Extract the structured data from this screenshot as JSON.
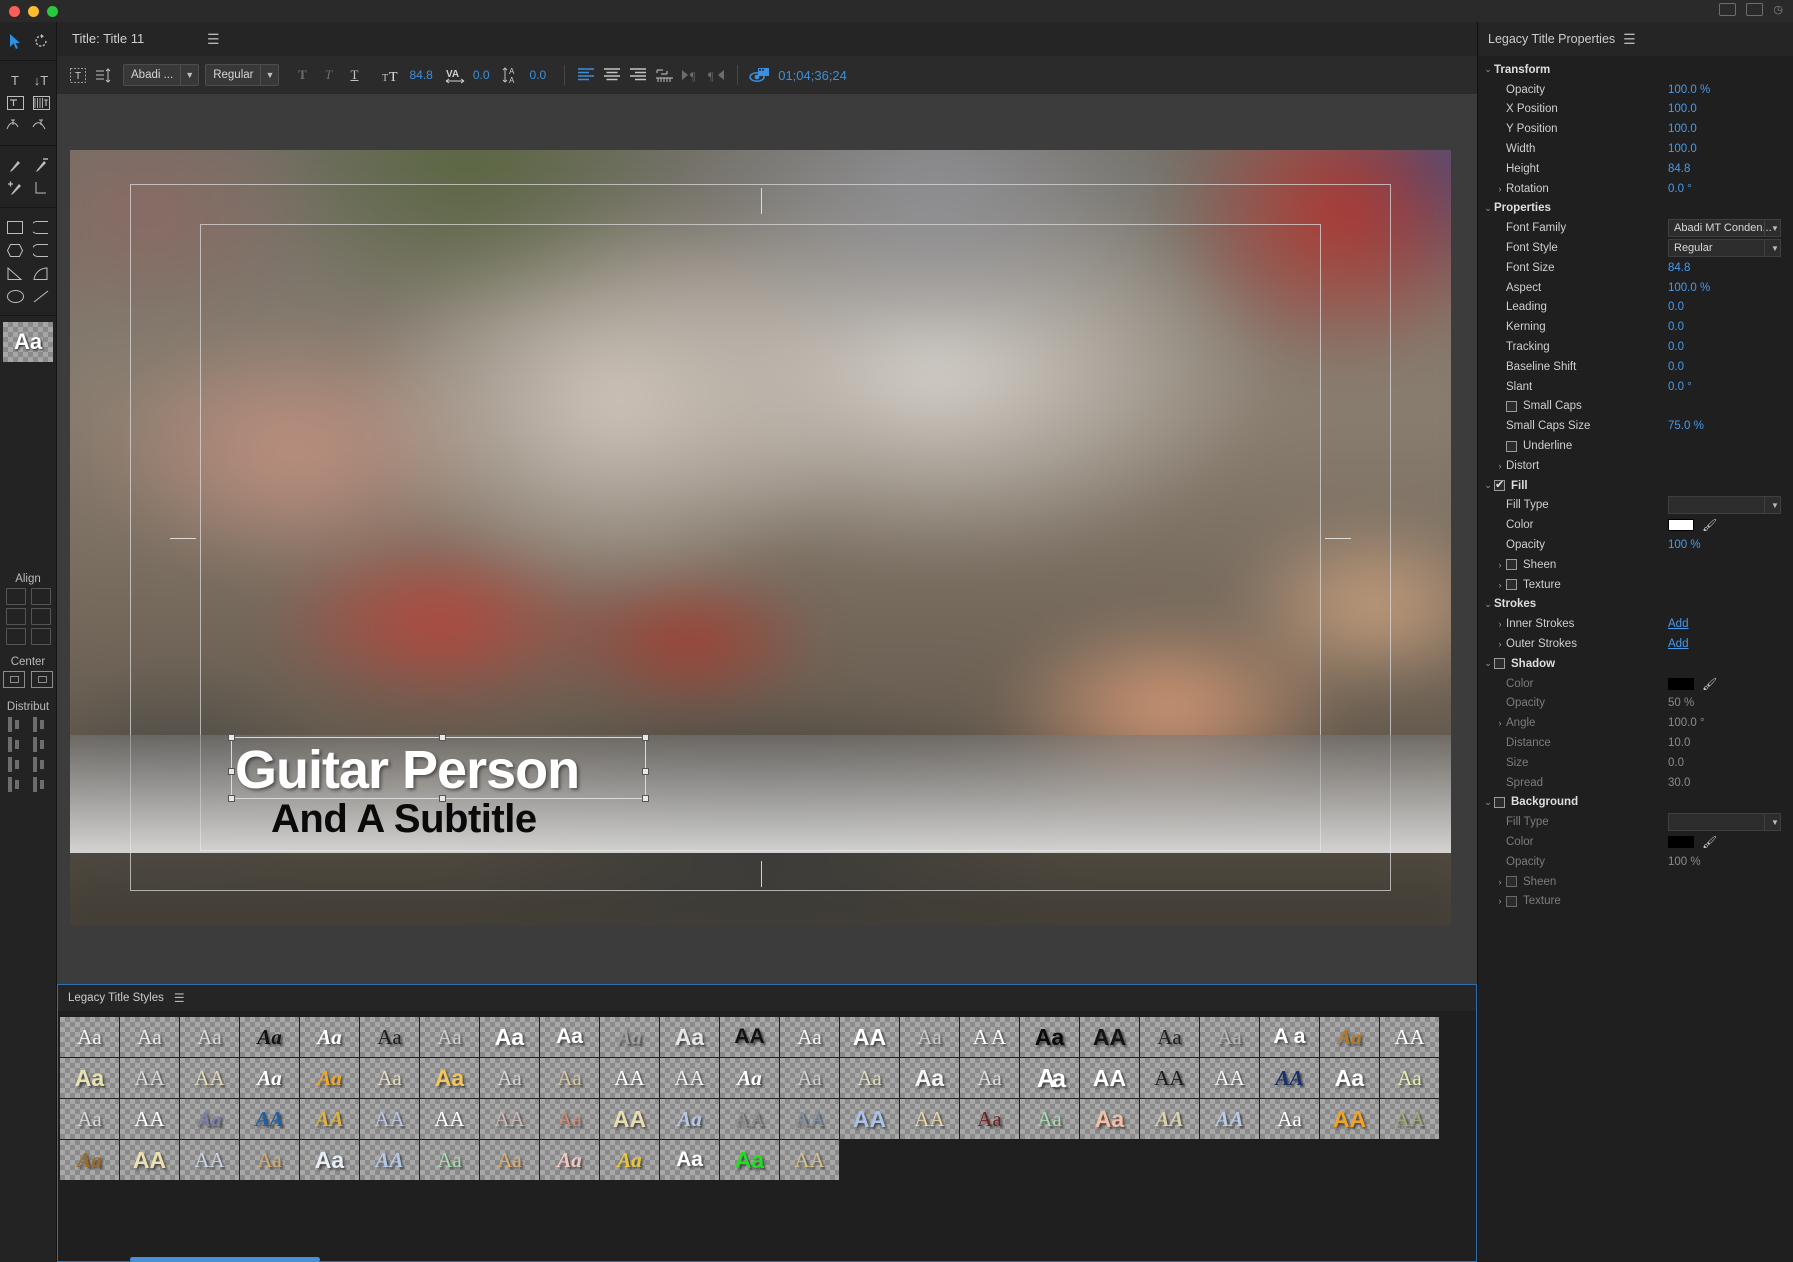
{
  "window": {
    "traffic": [
      "close",
      "minimize",
      "zoom"
    ]
  },
  "title_header": {
    "label": "Title: Title 11",
    "menu_icon": "hamburger-icon"
  },
  "toolbar": {
    "tools_icon": "text-mask-icon",
    "list_icon": "text-baseline-icon",
    "font_family": "Abadi ...",
    "font_style": "Regular",
    "bold_icon": "bold-icon",
    "italic_icon": "italic-icon",
    "underline_icon": "underline-icon",
    "font_size_icon": "font-size-icon",
    "font_size": "84.8",
    "kerning_icon": "kerning-icon",
    "kerning": "0.0",
    "leading_icon": "leading-icon",
    "leading": "0.0",
    "align_left_icon": "align-left-icon",
    "align_center_icon": "align-center-icon",
    "align_right_icon": "align-right-icon",
    "tab_stops_icon": "tab-stops-icon",
    "text_start_icon": "text-start-icon",
    "text_end_icon": "text-end-icon",
    "show_video_icon": "show-video-icon",
    "timecode": "01;04;36;24"
  },
  "tool_palette": {
    "selection_icon": "selection-arrow-icon",
    "rotation_icon": "rotation-icon",
    "type_icon": "type-tool-icon",
    "vertical_type_icon": "vertical-type-tool-icon",
    "area_type_icon": "area-type-tool-icon",
    "vertical_area_type_icon": "vertical-area-type-tool-icon",
    "path_type_icon": "path-type-tool-icon",
    "vertical_path_type_icon": "vertical-path-type-tool-icon",
    "pen_icon": "pen-tool-icon",
    "delete_anchor_icon": "delete-anchor-point-icon",
    "add_anchor_icon": "add-anchor-point-icon",
    "convert_anchor_icon": "convert-anchor-point-icon",
    "rectangle_icon": "rectangle-tool-icon",
    "rounded_corner_icon": "rounded-corner-rectangle-icon",
    "clipped_corner_icon": "clipped-corner-rectangle-icon",
    "rounded_rect_icon": "rounded-rectangle-icon",
    "wedge_icon": "wedge-tool-icon",
    "arc_icon": "arc-tool-icon",
    "ellipse_icon": "ellipse-tool-icon",
    "line_icon": "line-tool-icon",
    "sample_glyph": "Aa",
    "align_label": "Align",
    "center_label": "Center",
    "distribute_label": "Distribut"
  },
  "canvas": {
    "title_text": "Guitar Person",
    "subtitle_text": "And A Subtitle",
    "safe_action_name": "action-safe-margin",
    "safe_title_name": "title-safe-margin"
  },
  "properties_panel": {
    "header": "Legacy Title Properties",
    "menu_icon": "hamburger-icon",
    "sections": [
      {
        "name": "Transform",
        "expanded": true,
        "rows": [
          {
            "label": "Opacity",
            "value": "100.0 %",
            "type": "value"
          },
          {
            "label": "X Position",
            "value": "100.0",
            "type": "value"
          },
          {
            "label": "Y Position",
            "value": "100.0",
            "type": "value"
          },
          {
            "label": "Width",
            "value": "100.0",
            "type": "value"
          },
          {
            "label": "Height",
            "value": "84.8",
            "type": "value"
          },
          {
            "label": "Rotation",
            "value": "0.0 °",
            "type": "value",
            "twist": true
          }
        ]
      },
      {
        "name": "Properties",
        "expanded": true,
        "rows": [
          {
            "label": "Font Family",
            "value": "Abadi MT Conden...",
            "type": "dropdown"
          },
          {
            "label": "Font Style",
            "value": "Regular",
            "type": "dropdown"
          },
          {
            "label": "Font Size",
            "value": "84.8",
            "type": "value"
          },
          {
            "label": "Aspect",
            "value": "100.0 %",
            "type": "value"
          },
          {
            "label": "Leading",
            "value": "0.0",
            "type": "value"
          },
          {
            "label": "Kerning",
            "value": "0.0",
            "type": "value"
          },
          {
            "label": "Tracking",
            "value": "0.0",
            "type": "value"
          },
          {
            "label": "Baseline Shift",
            "value": "0.0",
            "type": "value"
          },
          {
            "label": "Slant",
            "value": "0.0 °",
            "type": "value"
          },
          {
            "label": "Small Caps",
            "value": "",
            "type": "checkbox",
            "checked": false
          },
          {
            "label": "Small Caps Size",
            "value": "75.0 %",
            "type": "value"
          },
          {
            "label": "Underline",
            "value": "",
            "type": "checkbox",
            "checked": false
          },
          {
            "label": "Distort",
            "value": "",
            "type": "label",
            "twist": true
          }
        ]
      },
      {
        "name": "Fill",
        "expanded": true,
        "checked": true,
        "rows": [
          {
            "label": "Fill Type",
            "value": "",
            "type": "dropdown"
          },
          {
            "label": "Color",
            "value": "#ffffff",
            "type": "color"
          },
          {
            "label": "Opacity",
            "value": "100 %",
            "type": "value"
          },
          {
            "label": "Sheen",
            "value": "",
            "type": "checkbox",
            "checked": false,
            "twist": true
          },
          {
            "label": "Texture",
            "value": "",
            "type": "checkbox",
            "checked": false,
            "twist": true
          }
        ]
      },
      {
        "name": "Strokes",
        "expanded": true,
        "rows": [
          {
            "label": "Inner Strokes",
            "value": "Add",
            "type": "link",
            "twist": true
          },
          {
            "label": "Outer Strokes",
            "value": "Add",
            "type": "link",
            "twist": true
          }
        ]
      },
      {
        "name": "Shadow",
        "expanded": true,
        "checked": false,
        "disabled": true,
        "rows": [
          {
            "label": "Color",
            "value": "#000000",
            "type": "color"
          },
          {
            "label": "Opacity",
            "value": "50 %",
            "type": "value"
          },
          {
            "label": "Angle",
            "value": "100.0 °",
            "type": "value",
            "twist": true
          },
          {
            "label": "Distance",
            "value": "10.0",
            "type": "value"
          },
          {
            "label": "Size",
            "value": "0.0",
            "type": "value"
          },
          {
            "label": "Spread",
            "value": "30.0",
            "type": "value"
          }
        ]
      },
      {
        "name": "Background",
        "expanded": true,
        "checked": false,
        "disabled": true,
        "rows": [
          {
            "label": "Fill Type",
            "value": "",
            "type": "dropdown"
          },
          {
            "label": "Color",
            "value": "#000000",
            "type": "color"
          },
          {
            "label": "Opacity",
            "value": "100 %",
            "type": "value"
          },
          {
            "label": "Sheen",
            "value": "",
            "type": "checkbox",
            "checked": false,
            "twist": true
          },
          {
            "label": "Texture",
            "value": "",
            "type": "checkbox",
            "checked": false,
            "twist": true
          }
        ]
      }
    ]
  },
  "styles_panel": {
    "header": "Legacy Title Styles",
    "menu_icon": "hamburger-icon",
    "swatches": [
      {
        "text": "Aa",
        "color": "#f2f2f2",
        "style": "serif"
      },
      {
        "text": "Aa",
        "color": "#e8e8e8",
        "style": "serif"
      },
      {
        "text": "Aa",
        "color": "#d8d8d8",
        "style": "serif"
      },
      {
        "text": "Aa",
        "color": "#111111",
        "style": "italic"
      },
      {
        "text": "Aa",
        "color": "#ffffff",
        "style": "italic"
      },
      {
        "text": "Aa",
        "color": "#1a1a1a",
        "style": "serif"
      },
      {
        "text": "Aa",
        "color": "#cfcfcf",
        "style": "serif"
      },
      {
        "text": "Aa",
        "color": "#ffffff",
        "style": "fat"
      },
      {
        "text": "Aa",
        "color": "#ffffff",
        "style": "sans"
      },
      {
        "text": "Aa",
        "color": "#9d9d9d",
        "style": "script"
      },
      {
        "text": "Aa",
        "color": "#e6e6e6",
        "style": "fat"
      },
      {
        "text": "AA",
        "color": "#111111",
        "style": "sans"
      },
      {
        "text": "Aa",
        "color": "#f5f5f5",
        "style": "serif"
      },
      {
        "text": "AA",
        "color": "#ffffff",
        "style": "fat"
      },
      {
        "text": "Aa",
        "color": "#c9c9c9",
        "style": "serif"
      },
      {
        "text": "A A",
        "color": "#ffffff",
        "style": "serif"
      },
      {
        "text": "Aa",
        "color": "#0a0a0a",
        "style": "fat"
      },
      {
        "text": "AA",
        "color": "#141414",
        "style": "fat"
      },
      {
        "text": "Aa",
        "color": "#1c1c1c",
        "style": "serif"
      },
      {
        "text": "Aa",
        "color": "#b6b6b6",
        "style": "serif"
      },
      {
        "text": "A a",
        "color": "#ffffff",
        "style": "sans"
      },
      {
        "text": "Aa",
        "color": "#b87a26",
        "style": "italic"
      },
      {
        "text": "AA",
        "color": "#ffffff",
        "style": "serif"
      },
      {
        "text": "Aa",
        "color": "#e8e2b0",
        "style": "fat"
      },
      {
        "text": "AA",
        "color": "#d8d8d8",
        "style": "serif"
      },
      {
        "text": "AA",
        "color": "#e3d9b4",
        "style": "serif"
      },
      {
        "text": "Aa",
        "color": "#ffffff",
        "style": "italic"
      },
      {
        "text": "Aa",
        "color": "#f0a82a",
        "style": "italic"
      },
      {
        "text": "Aa",
        "color": "#e8dcc0",
        "style": "serif"
      },
      {
        "text": "Aa",
        "color": "#f1c75a",
        "style": "fat"
      },
      {
        "text": "Aa",
        "color": "#d5d5d5",
        "style": "serif"
      },
      {
        "text": "Aa",
        "color": "#d8c59a",
        "style": "serif"
      },
      {
        "text": "AA",
        "color": "#ffffff",
        "style": "serif"
      },
      {
        "text": "AA",
        "color": "#efefef",
        "style": "serif"
      },
      {
        "text": "Aa",
        "color": "#ffffff",
        "style": "italic"
      },
      {
        "text": "Aa",
        "color": "#cfcfcf",
        "style": "serif"
      },
      {
        "text": "Aa",
        "color": "#e0dcb8",
        "style": "serif"
      },
      {
        "text": "Aa",
        "color": "#f6f6f6",
        "style": "fat"
      },
      {
        "text": "Aa",
        "color": "#dedede",
        "style": "serif"
      },
      {
        "text": "Aa",
        "color": "#ffffff",
        "style": "swoosh"
      },
      {
        "text": "AA",
        "color": "#ffffff",
        "style": "fat"
      },
      {
        "text": "AA",
        "color": "#1a1a1a",
        "style": "serif"
      },
      {
        "text": "AA",
        "color": "#f2f2f2",
        "style": "serif"
      },
      {
        "text": "AA",
        "color": "#17306b",
        "style": "italic"
      },
      {
        "text": "Aa",
        "color": "#ffffff",
        "style": "fat"
      },
      {
        "text": "Aa",
        "color": "#e6efa8",
        "style": "serif"
      },
      {
        "text": "Aa",
        "color": "#d6d6d6",
        "style": "serif"
      },
      {
        "text": "AA",
        "color": "#ffffff",
        "style": "serif"
      },
      {
        "text": "Aa",
        "color": "#7b7fa8",
        "style": "italic"
      },
      {
        "text": "AA",
        "color": "#1f5fa8",
        "style": "italic"
      },
      {
        "text": "AA",
        "color": "#e0b23c",
        "style": "italic"
      },
      {
        "text": "AA",
        "color": "#b9c6e8",
        "style": "serif"
      },
      {
        "text": "AA",
        "color": "#ffffff",
        "style": "serif"
      },
      {
        "text": "AA",
        "color": "#cfb8b4",
        "style": "serif"
      },
      {
        "text": "Aa",
        "color": "#cf8a72",
        "style": "serif"
      },
      {
        "text": "AA",
        "color": "#e8dcb0",
        "style": "fat"
      },
      {
        "text": "Aa",
        "color": "#b6c8e6",
        "style": "italic"
      },
      {
        "text": "AA",
        "color": "#8e8e8e",
        "style": "serif"
      },
      {
        "text": "AA",
        "color": "#7f8fa6",
        "style": "serif"
      },
      {
        "text": "AA",
        "color": "#aac2e8",
        "style": "fat"
      },
      {
        "text": "AA",
        "color": "#e8d5a0",
        "style": "serif"
      },
      {
        "text": "Aa",
        "color": "#6e1f1c",
        "style": "serif"
      },
      {
        "text": "Aa",
        "color": "#a8dcae",
        "style": "serif"
      },
      {
        "text": "Aa",
        "color": "#f2bfa6",
        "style": "fat"
      },
      {
        "text": "AA",
        "color": "#d8d2a8",
        "style": "italic"
      },
      {
        "text": "AA",
        "color": "#b9cbe8",
        "style": "italic"
      },
      {
        "text": "Aa",
        "color": "#ffffff",
        "style": "serif"
      },
      {
        "text": "AA",
        "color": "#f0a22a",
        "style": "fat"
      },
      {
        "text": "AA",
        "color": "#9dae72",
        "style": "serif"
      },
      {
        "text": "Aa",
        "color": "#9a6a2a",
        "style": "italic"
      },
      {
        "text": "AA",
        "color": "#ede0b0",
        "style": "fat"
      },
      {
        "text": "AA",
        "color": "#c8d4e8",
        "style": "serif"
      },
      {
        "text": "Aa",
        "color": "#d8ab68",
        "style": "serif"
      },
      {
        "text": "Aa",
        "color": "#e8eef6",
        "style": "fat"
      },
      {
        "text": "AA",
        "color": "#b6c8e8",
        "style": "italic"
      },
      {
        "text": "Aa",
        "color": "#a8dcae",
        "style": "serif"
      },
      {
        "text": "Aa",
        "color": "#e0b06a",
        "style": "serif"
      },
      {
        "text": "Aa",
        "color": "#f0c8c0",
        "style": "italic"
      },
      {
        "text": "Aa",
        "color": "#e8c83a",
        "style": "italic"
      },
      {
        "text": "Aa",
        "color": "#ffffff",
        "style": "sans"
      },
      {
        "text": "Aa",
        "color": "#22dd22",
        "style": "fat"
      },
      {
        "text": "AA",
        "color": "#d8c08a",
        "style": "serif"
      }
    ]
  }
}
